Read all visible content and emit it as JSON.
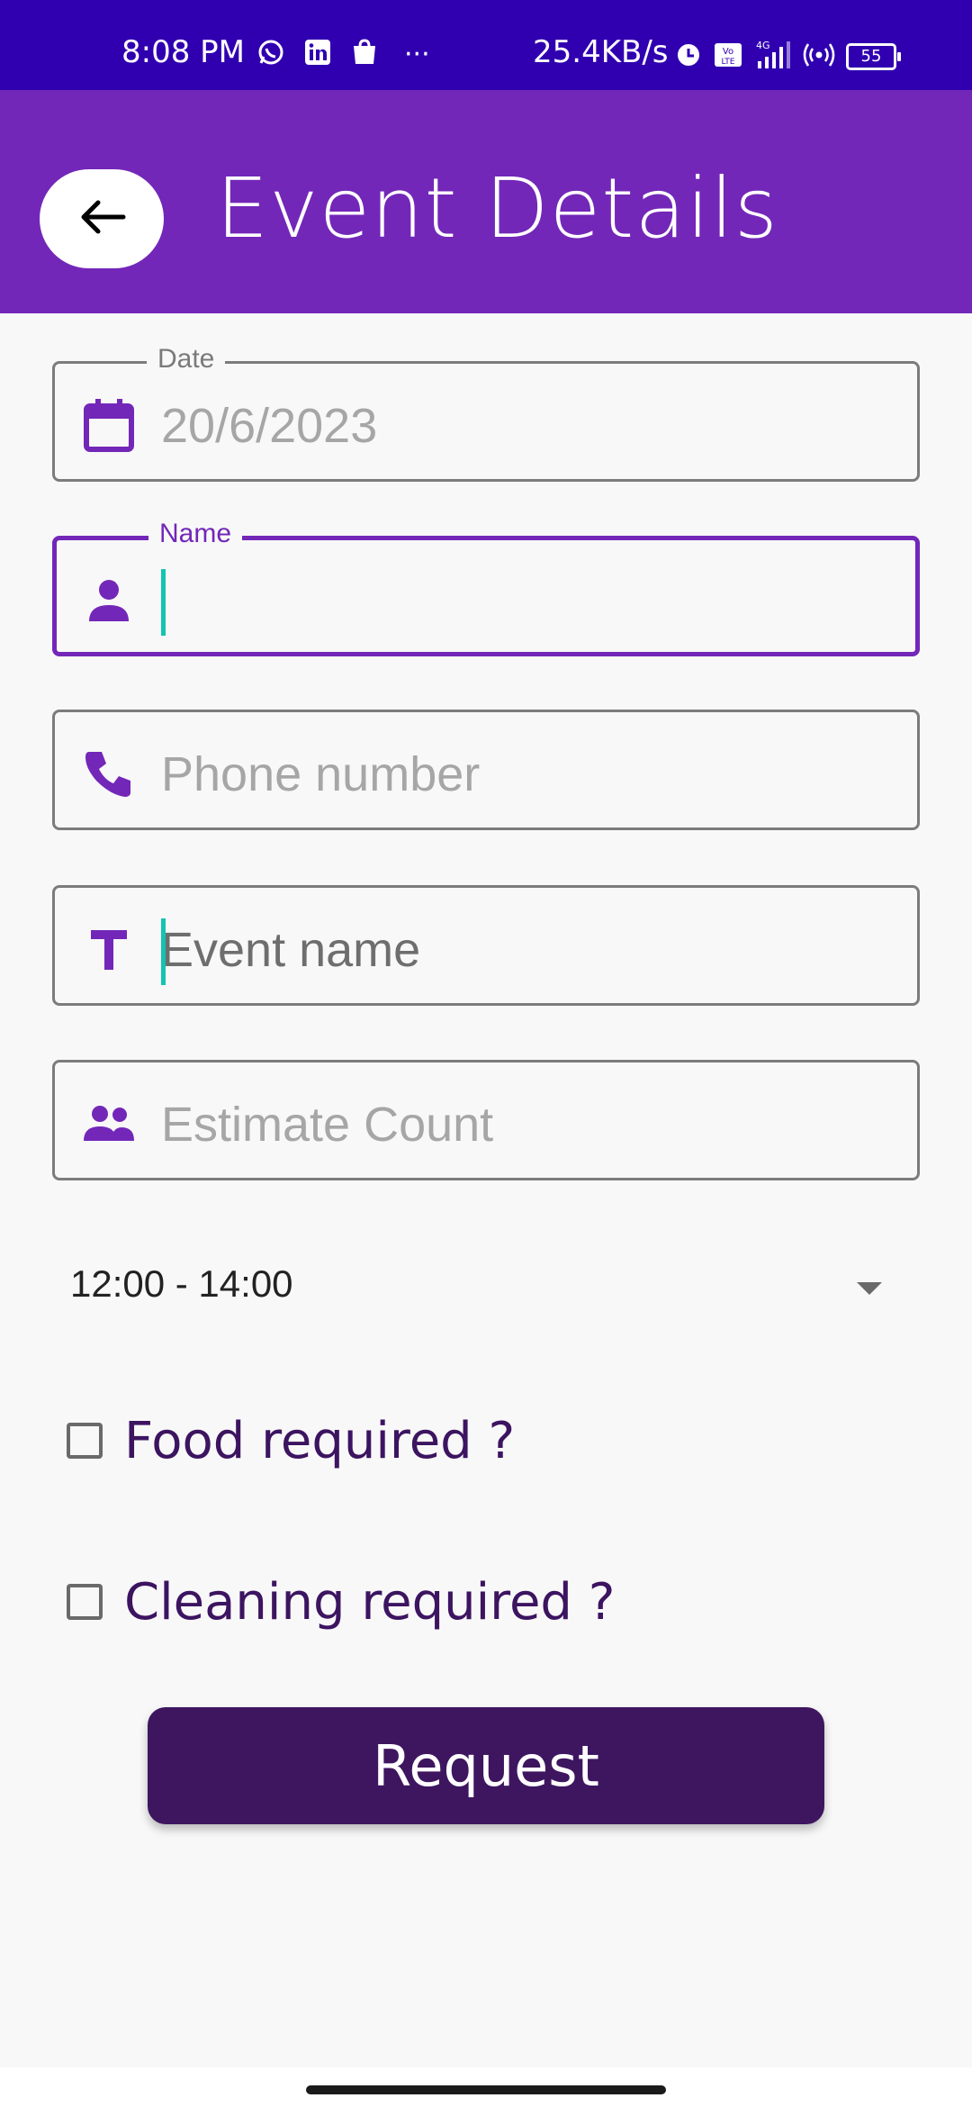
{
  "status_bar": {
    "time": "8:08 PM",
    "net_speed": "25.4KB/s",
    "battery": "55",
    "more": "···",
    "icons": [
      "whatsapp-icon",
      "linkedin-icon",
      "shopping-bag-icon",
      "alarm-icon",
      "volte-icon",
      "signal-4g-icon",
      "hotspot-icon",
      "battery-icon"
    ]
  },
  "app_bar": {
    "title": "Event Details",
    "back_icon": "arrow-left-icon"
  },
  "form": {
    "date": {
      "label": "Date",
      "value": "20/6/2023",
      "icon": "calendar-icon"
    },
    "name": {
      "label": "Name",
      "value": "",
      "icon": "person-icon"
    },
    "phone": {
      "placeholder": "Phone number",
      "icon": "phone-icon"
    },
    "event_name": {
      "placeholder": "Event name",
      "icon": "text-t-icon"
    },
    "estimate": {
      "placeholder": "Estimate Count",
      "icon": "people-icon"
    },
    "time_slot": {
      "value": "12:00 - 14:00"
    },
    "food": {
      "label": "Food required ?",
      "checked": false
    },
    "cleaning": {
      "label": "Cleaning required ?",
      "checked": false
    },
    "submit_label": "Request"
  },
  "colors": {
    "status_bar": "#3000b0",
    "app_bar": "#7327b8",
    "accent": "#7327b8",
    "button": "#3e1660",
    "cursor": "#13c4b0"
  }
}
